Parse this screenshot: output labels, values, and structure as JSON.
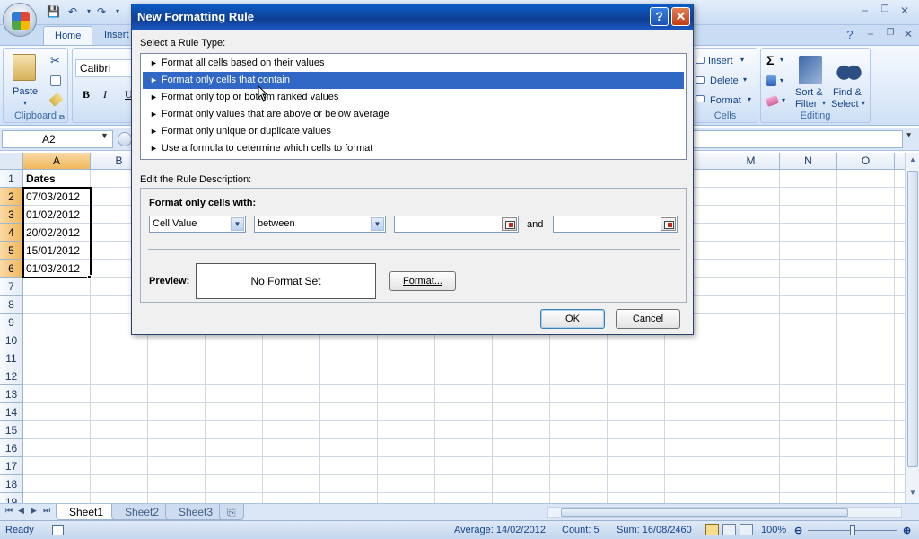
{
  "window": {
    "min": "−",
    "restore": "❐",
    "close": "✕"
  },
  "ribbon": {
    "tabs": [
      "Home",
      "Insert"
    ],
    "clipboard": {
      "label": "Clipboard",
      "paste": "Paste"
    },
    "font": {
      "name": "Calibri",
      "bold": "B",
      "italic": "I",
      "underline": "U"
    },
    "cells": {
      "label": "Cells",
      "insert": "Insert",
      "delete": "Delete",
      "format": "Format"
    },
    "editing": {
      "label": "Editing",
      "sort1": "Sort &",
      "sort2": "Filter",
      "find1": "Find &",
      "find2": "Select"
    }
  },
  "formula": {
    "name_box": "A2"
  },
  "grid": {
    "columns": [
      "A",
      "B",
      "M",
      "N",
      "O"
    ],
    "rows": [
      "1",
      "2",
      "3",
      "4",
      "5",
      "6",
      "7",
      "8",
      "9",
      "10",
      "11",
      "12",
      "13",
      "14",
      "15",
      "16",
      "17",
      "18",
      "19"
    ],
    "cells": [
      "Dates",
      "07/03/2012",
      "01/02/2012",
      "20/02/2012",
      "15/01/2012",
      "01/03/2012"
    ]
  },
  "sheets": [
    "Sheet1",
    "Sheet2",
    "Sheet3"
  ],
  "status": {
    "ready": "Ready",
    "average": "Average: 14/02/2012",
    "count": "Count: 5",
    "sum": "Sum: 16/08/2460",
    "zoom": "100%"
  },
  "dialog": {
    "title": "New Formatting Rule",
    "help": "?",
    "close": "✕",
    "select_label": "Select a Rule Type:",
    "rule_types": [
      "Format all cells based on their values",
      "Format only cells that contain",
      "Format only top or bottom ranked values",
      "Format only values that are above or below average",
      "Format only unique or duplicate values",
      "Use a formula to determine which cells to format"
    ],
    "edit_label": "Edit the Rule Description:",
    "format_only_label": "Format only cells with:",
    "cell_value": "Cell Value",
    "operator": "between",
    "and_label": "and",
    "preview_label": "Preview:",
    "preview_text": "No Format Set",
    "format_button": "Format...",
    "ok": "OK",
    "cancel": "Cancel"
  },
  "colors": {
    "accent": "#3168c5",
    "title_bar": "#0f3f93",
    "selected_header": "#f1b75c"
  }
}
